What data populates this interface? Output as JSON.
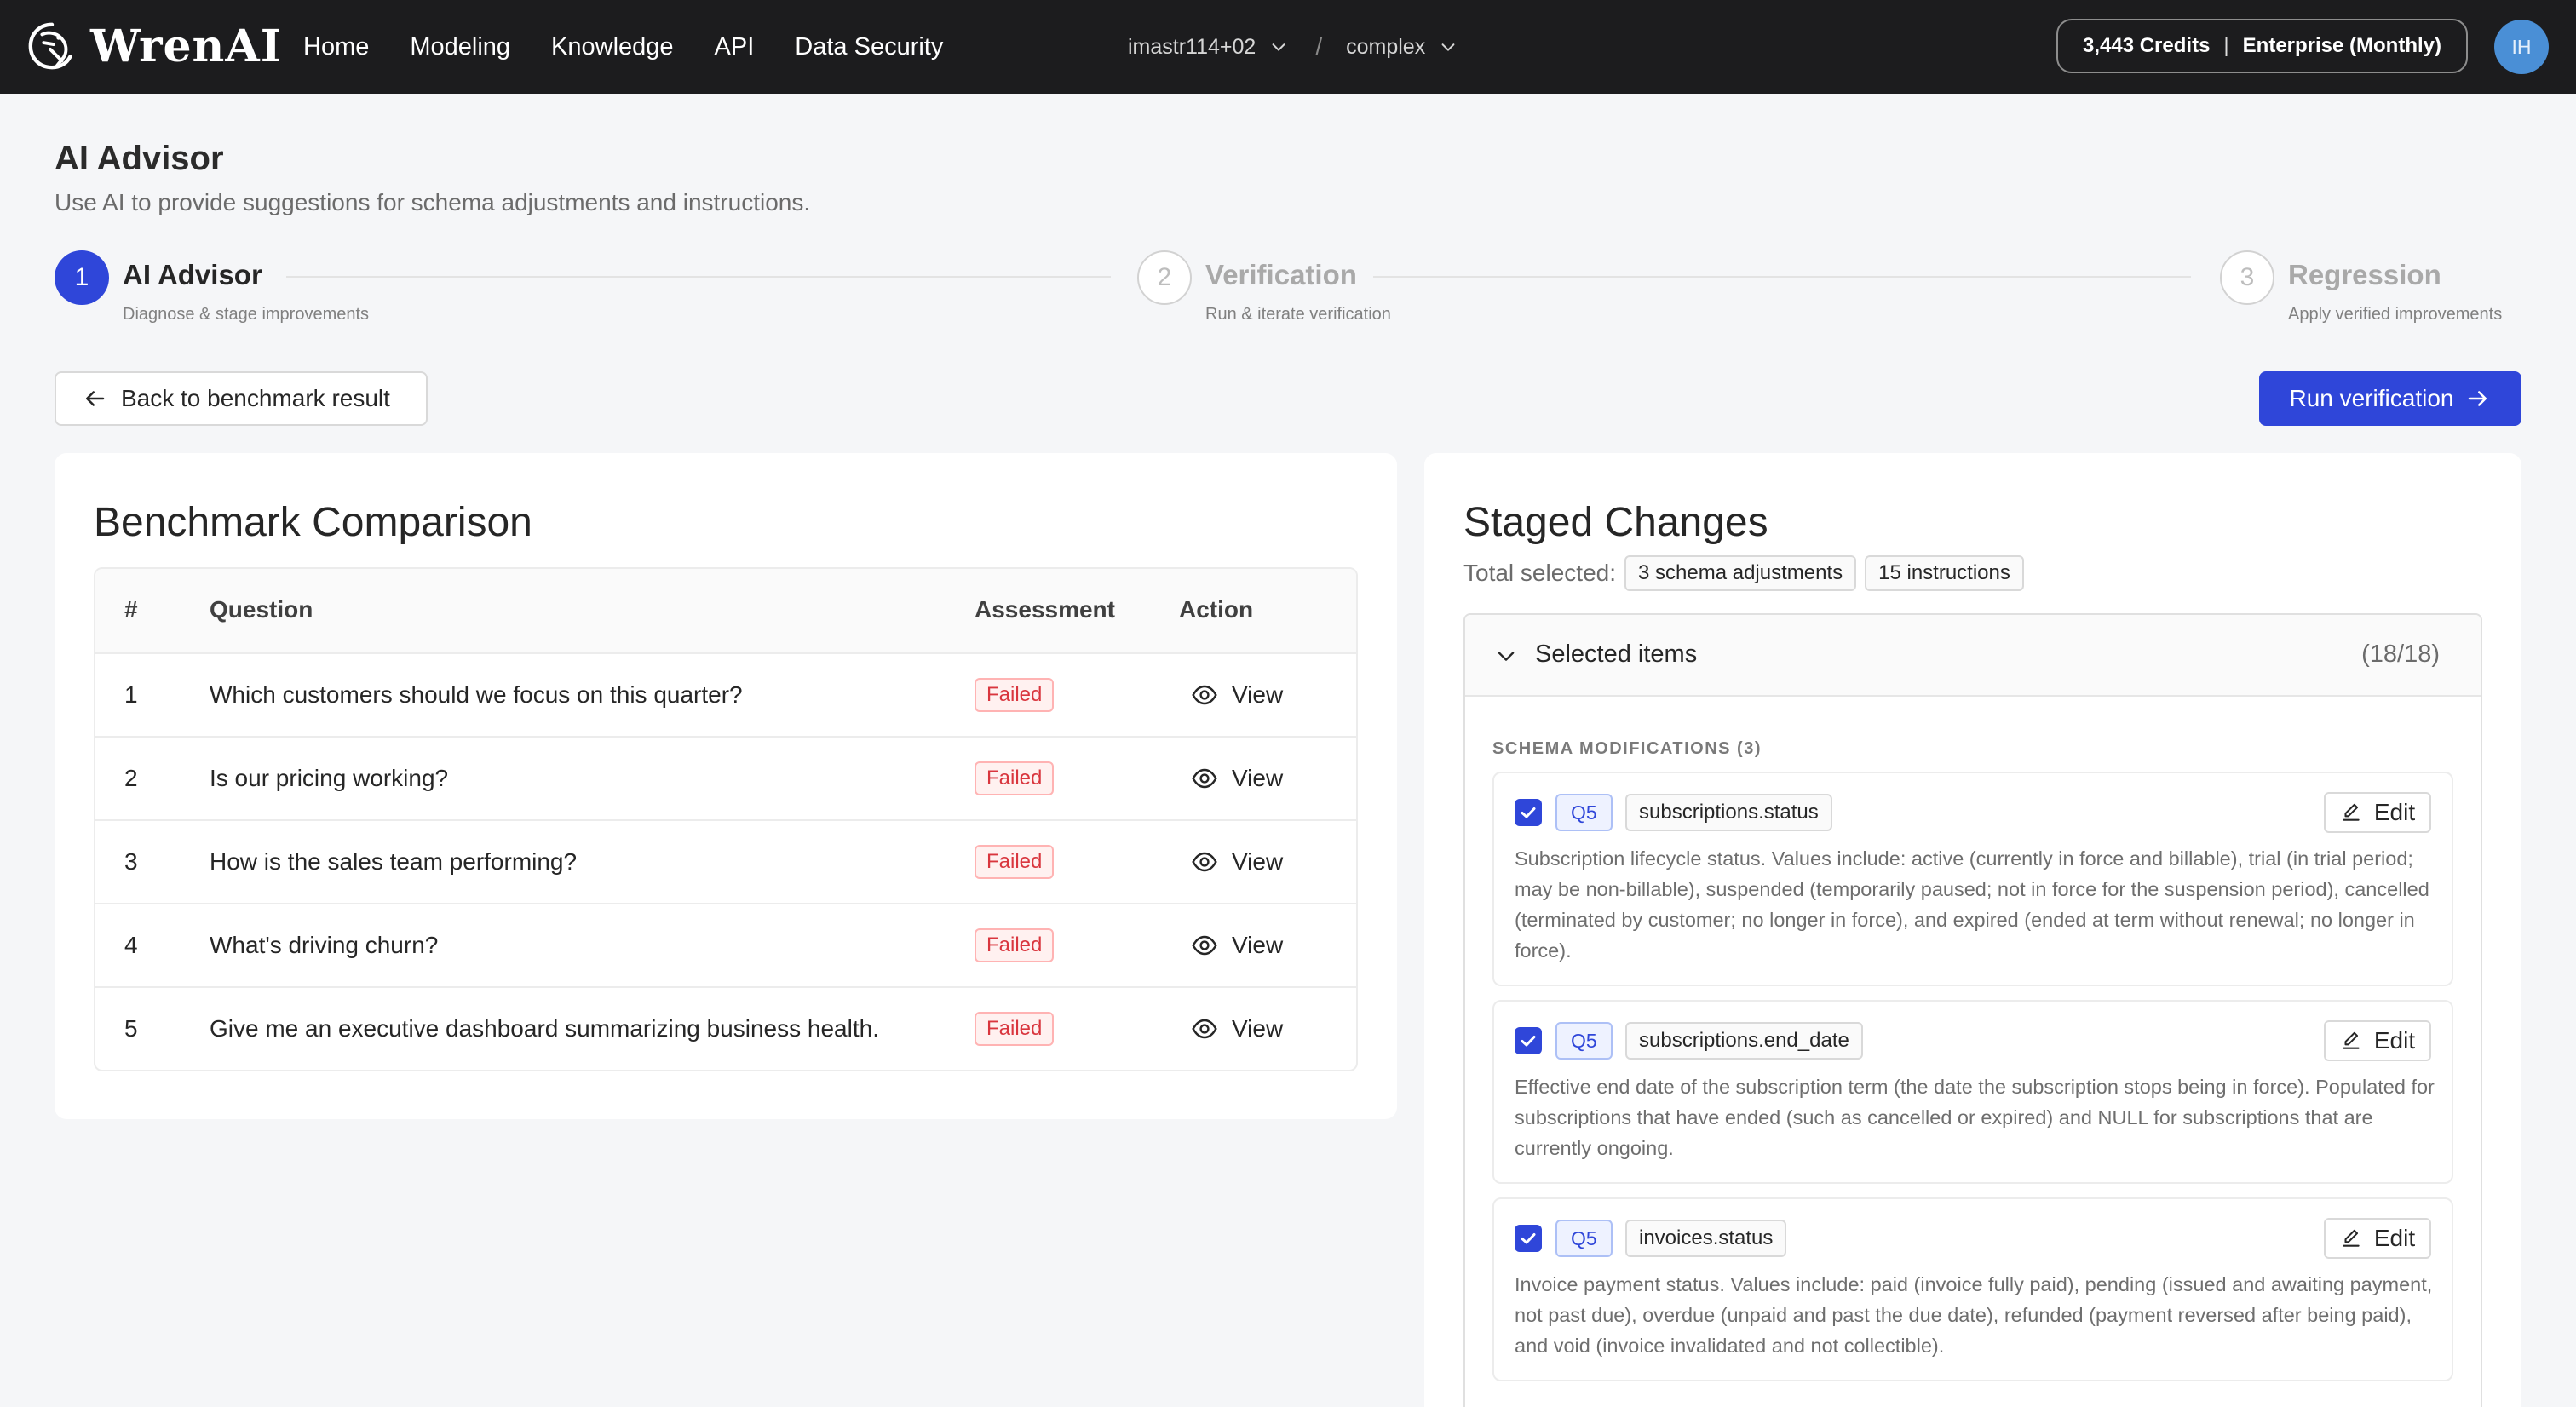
{
  "app": {
    "brand": "WrenAI"
  },
  "nav": {
    "items": [
      "Home",
      "Modeling",
      "Knowledge",
      "API",
      "Data Security"
    ]
  },
  "project": {
    "workspace": "imastr114+02",
    "separator": "/",
    "dataset": "complex"
  },
  "account": {
    "credits": "3,443 Credits",
    "plan": "Enterprise (Monthly)",
    "initials": "IH"
  },
  "page": {
    "title": "AI Advisor",
    "subtitle": "Use AI to provide suggestions for schema adjustments and instructions."
  },
  "steps": [
    {
      "number": "1",
      "title": "AI Advisor",
      "description": "Diagnose & stage improvements",
      "active": true
    },
    {
      "number": "2",
      "title": "Verification",
      "description": "Run & iterate verification",
      "active": false
    },
    {
      "number": "3",
      "title": "Regression",
      "description": "Apply verified improvements",
      "active": false
    }
  ],
  "actions": {
    "back_label": "Back to benchmark result",
    "run_label": "Run verification"
  },
  "benchmark": {
    "title": "Benchmark Comparison",
    "columns": [
      "#",
      "Question",
      "Assessment",
      "Action"
    ],
    "rows": [
      {
        "num": "1",
        "question": "Which customers should we focus on this quarter?",
        "assessment": "Failed",
        "action": "View"
      },
      {
        "num": "2",
        "question": "Is our pricing working?",
        "assessment": "Failed",
        "action": "View"
      },
      {
        "num": "3",
        "question": "How is the sales team performing?",
        "assessment": "Failed",
        "action": "View"
      },
      {
        "num": "4",
        "question": "What's driving churn?",
        "assessment": "Failed",
        "action": "View"
      },
      {
        "num": "5",
        "question": "Give me an executive dashboard summarizing business health.",
        "assessment": "Failed",
        "action": "View"
      }
    ]
  },
  "staged": {
    "title": "Staged Changes",
    "total_label": "Total selected:",
    "tags": [
      "3 schema adjustments",
      "15 instructions"
    ],
    "selected": {
      "label": "Selected items",
      "count": "(18/18)"
    },
    "section_label": "SCHEMA MODIFICATIONS (3)",
    "items": [
      {
        "question_tag": "Q5",
        "column": "subscriptions.status",
        "edit_label": "Edit",
        "description": "Subscription lifecycle status. Values include: active (currently in force and billable), trial (in trial period; may be non-billable), suspended (temporarily paused; not in force for the suspension period), cancelled (terminated by customer; no longer in force), and expired (ended at term without renewal; no longer in force)."
      },
      {
        "question_tag": "Q5",
        "column": "subscriptions.end_date",
        "edit_label": "Edit",
        "description": "Effective end date of the subscription term (the date the subscription stops being in force). Populated for subscriptions that have ended (such as cancelled or expired) and NULL for subscriptions that are currently ongoing."
      },
      {
        "question_tag": "Q5",
        "column": "invoices.status",
        "edit_label": "Edit",
        "description": "Invoice payment status. Values include: paid (invoice fully paid), pending (issued and awaiting payment, not past due), overdue (unpaid and past the due date), refunded (payment reversed after being paid), and void (invoice invalidated and not collectible)."
      }
    ]
  },
  "colors": {
    "primary": "#2f46d9",
    "topbar": "#1c1c1e",
    "failed": "#d9363e",
    "avatar": "#4a8fd6"
  }
}
